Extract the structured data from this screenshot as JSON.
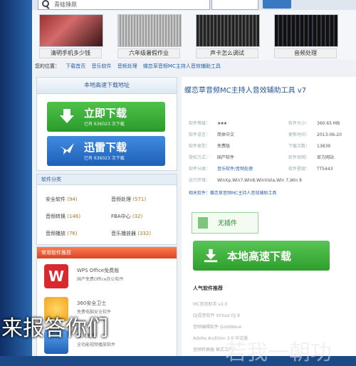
{
  "search": {
    "value": "青蛙锤鼎",
    "button_label": ""
  },
  "thumbs": [
    {
      "caption": "清明手机多少钱",
      "color": "#7a2a2a"
    },
    {
      "caption": "六年级暑假作业",
      "color": "#b8b8b8"
    },
    {
      "caption": "声卡怎么调试",
      "color": "#2b2b3a"
    },
    {
      "caption": "音频处理",
      "color": "#1a1a24"
    }
  ],
  "breadcrumb": {
    "prefix": "您的位置：",
    "items": [
      "下载首页",
      "音乐软件",
      "音频处理"
    ],
    "current": "蝶恋草音频MC主持人音效辅助工具"
  },
  "download": {
    "header": "本地高速下载地址",
    "primary": {
      "label": "立即下载",
      "sub": "已有 636023 次下载"
    },
    "secondary": {
      "label": "迅雷下载",
      "sub": "已有 636023 次下载"
    }
  },
  "categories": {
    "header": "软件分类",
    "items": [
      {
        "name": "安全软件",
        "count": "(94)"
      },
      {
        "name": "音频处理",
        "count": "(571)"
      },
      {
        "name": "音频转换",
        "count": "(146)"
      },
      {
        "name": "FBA中心",
        "count": "(32)"
      },
      {
        "name": "音频播放",
        "count": "(76)"
      },
      {
        "name": "音乐播放器",
        "count": "(332)"
      }
    ]
  },
  "recommend": {
    "header": "常用软件推荐",
    "items": [
      {
        "name": "WPS Office免费版",
        "desc": "国产免费Office办公软件",
        "icon_color": "#d8292f",
        "icon_text": "W"
      },
      {
        "name": "360安全卫士",
        "desc": "免费电脑安全软件",
        "icon_color": "#f3a31a",
        "icon_text": ""
      },
      {
        "name": "暴风影音",
        "desc": "全功能视频播放软件",
        "icon_color": "#2b79d1",
        "icon_text": ""
      }
    ]
  },
  "detail": {
    "title": "蝶恋草音频MC主持人音效辅助工具 v7",
    "rows": [
      {
        "k": "软件等级：",
        "v": "★★★"
      },
      {
        "k": "软件语言：",
        "v": "简体中文"
      },
      {
        "k": "软件类型：",
        "v": "免费版"
      },
      {
        "k": "授权方式：",
        "v": "国产软件"
      },
      {
        "k": "软件分类：",
        "v": "音乐软件/音频处理"
      },
      {
        "k": "运行环境：",
        "v": "WinXp,Win7,Win8,WinVista,Win 7,Win 8"
      }
    ],
    "right_rows": [
      {
        "k": "软件大小：",
        "v": "360.65 MB"
      },
      {
        "k": "更新时间：",
        "v": "2013-06-20"
      },
      {
        "k": "下载次数：",
        "v": "13839"
      },
      {
        "k": "软件官网：",
        "v": "官方网站"
      },
      {
        "k": "软件星级：",
        "v": "TT5443"
      }
    ],
    "related_label": "相关软件：蝶恋草音频MC主持人音效辅助工具",
    "plugin_label": "无插件",
    "local_download": "本地高速下载",
    "hot_title": "人气软件推荐",
    "hot_lines": [
      "MC音效助手 v2.0",
      "DJ混音软件 Virtual DJ 8",
      "音频编辑软件 GoldWave",
      "Adobe Audition 3.0 中文版",
      "音频转换器 格式工厂"
    ]
  },
  "overlay": {
    "left": "来报答你们",
    "right": "若我一朝功"
  }
}
